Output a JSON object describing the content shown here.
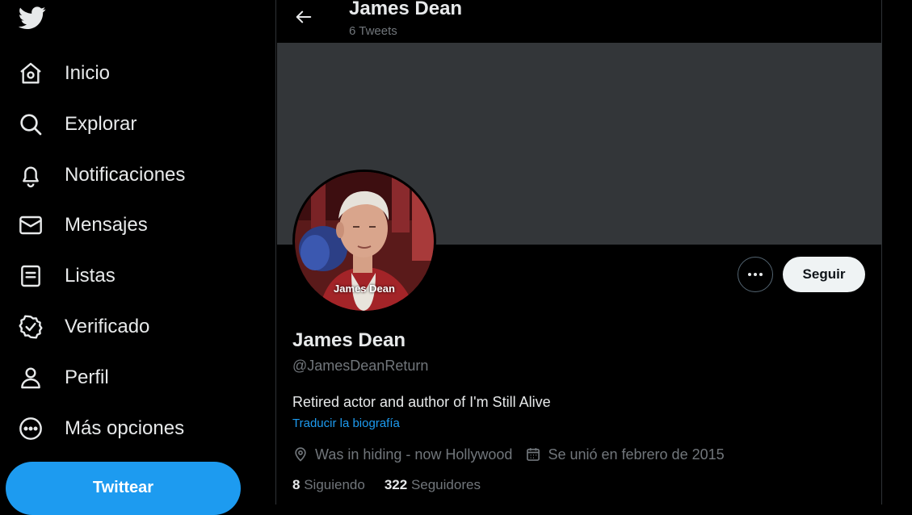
{
  "nav": {
    "items": [
      {
        "label": "Inicio",
        "icon": "home-icon"
      },
      {
        "label": "Explorar",
        "icon": "search-icon"
      },
      {
        "label": "Notificaciones",
        "icon": "bell-icon"
      },
      {
        "label": "Mensajes",
        "icon": "envelope-icon"
      },
      {
        "label": "Listas",
        "icon": "list-icon"
      },
      {
        "label": "Verificado",
        "icon": "verified-badge-icon"
      },
      {
        "label": "Perfil",
        "icon": "person-icon"
      },
      {
        "label": "Más opciones",
        "icon": "more-circle-icon"
      }
    ],
    "tweet_label": "Twittear"
  },
  "header": {
    "name": "James Dean",
    "tweet_count": "6 Tweets"
  },
  "profile": {
    "avatar_caption": "James Dean",
    "follow_label": "Seguir",
    "name": "James Dean",
    "handle": "@JamesDeanReturn",
    "bio": "Retired actor and author of I'm Still Alive",
    "translate_label": "Traducir la biografía",
    "location": "Was in hiding - now Hollywood",
    "joined": "Se unió en febrero de 2015",
    "following_count": "8",
    "following_label": "Siguiendo",
    "followers_count": "322",
    "followers_label": "Seguidores"
  },
  "colors": {
    "accent": "#1d9bf0",
    "background": "#000000",
    "banner": "#333639",
    "muted_text": "#71767b"
  }
}
